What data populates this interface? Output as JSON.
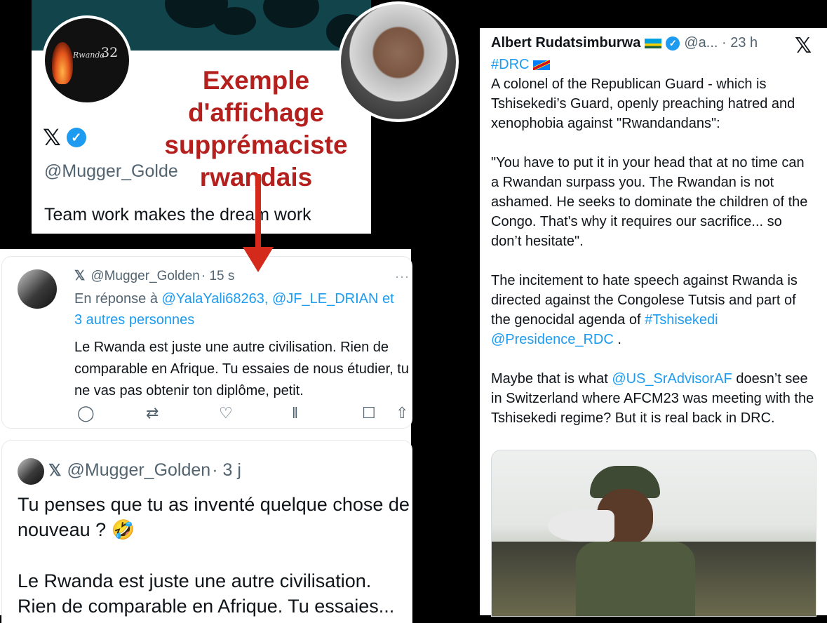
{
  "profile": {
    "avatar_logo_text": "Rwanda",
    "avatar_logo_number": "32",
    "handle": "@Mugger_Golde",
    "bio": "Team work makes the dream work"
  },
  "caption": {
    "lines": [
      "Exemple",
      "d'affichage",
      "supprémaciste",
      "rwandais"
    ],
    "color": "#b4201d"
  },
  "reply_tweet": {
    "x_icon": "𝕏",
    "handle": "@Mugger_Golden",
    "time": "· 15 s",
    "more": "···",
    "reply_prefix": "En réponse à",
    "reply_targets": "@YalaYali68263, @JF_LE_DRIAN et",
    "reply_more": "3 autres personnes",
    "text": "Le Rwanda est juste une autre civilisation. Rien de comparable en Afrique. Tu essaies de nous étudier, tu ne vas pas obtenir ton diplôme, petit.",
    "actions": {
      "reply_icon": "◯",
      "retweet_icon": "⇄",
      "like_icon": "♡",
      "views_icon": "‖",
      "bookmark_icon": "☐",
      "share_icon": "⇧"
    }
  },
  "second_tweet": {
    "handle": "@Mugger_Golden",
    "time": "· 3 j",
    "text1": "Tu penses que tu as inventé quelque chose de nouveau ? 🤣",
    "text2": "Le Rwanda est juste une autre civilisation. Rien de comparable en Afrique. Tu essaies..."
  },
  "right_tweet": {
    "name": "Albert Rudatsimburwa",
    "handle_time": "@a... · 23 h",
    "x_logo": "𝕏",
    "hashtag_drc": "#DRC",
    "para1": "A colonel of the Republican Guard  - which is Tshisekedi’s Guard, openly preaching hatred and xenophobia against \"Rwandandans\":",
    "para2": "\"You have to put it in your head that at no time can a Rwandan surpass you. The Rwandan is not ashamed. He seeks to dominate the children of the Congo. That's why it requires our sacrifice... so don’t hesitate\".",
    "para3_a": "The incitement to hate speech against Rwanda is directed against the Congolese Tutsis and part of the genocidal agenda of",
    "para3_tag": "#Tshisekedi",
    "para3_mention": "@Presidence_RDC",
    "para3_end": ".",
    "para4_a": "Maybe that is what",
    "para4_mention": "@US_SrAdvisorAF",
    "para4_b": "doesn’t see in Switzerland where AFCM23 was meeting with the Tshisekedi regime? But it is real back in DRC."
  },
  "colors": {
    "link": "#1d9bf0",
    "banner": "#12444c",
    "arrow": "#d42a1c"
  }
}
